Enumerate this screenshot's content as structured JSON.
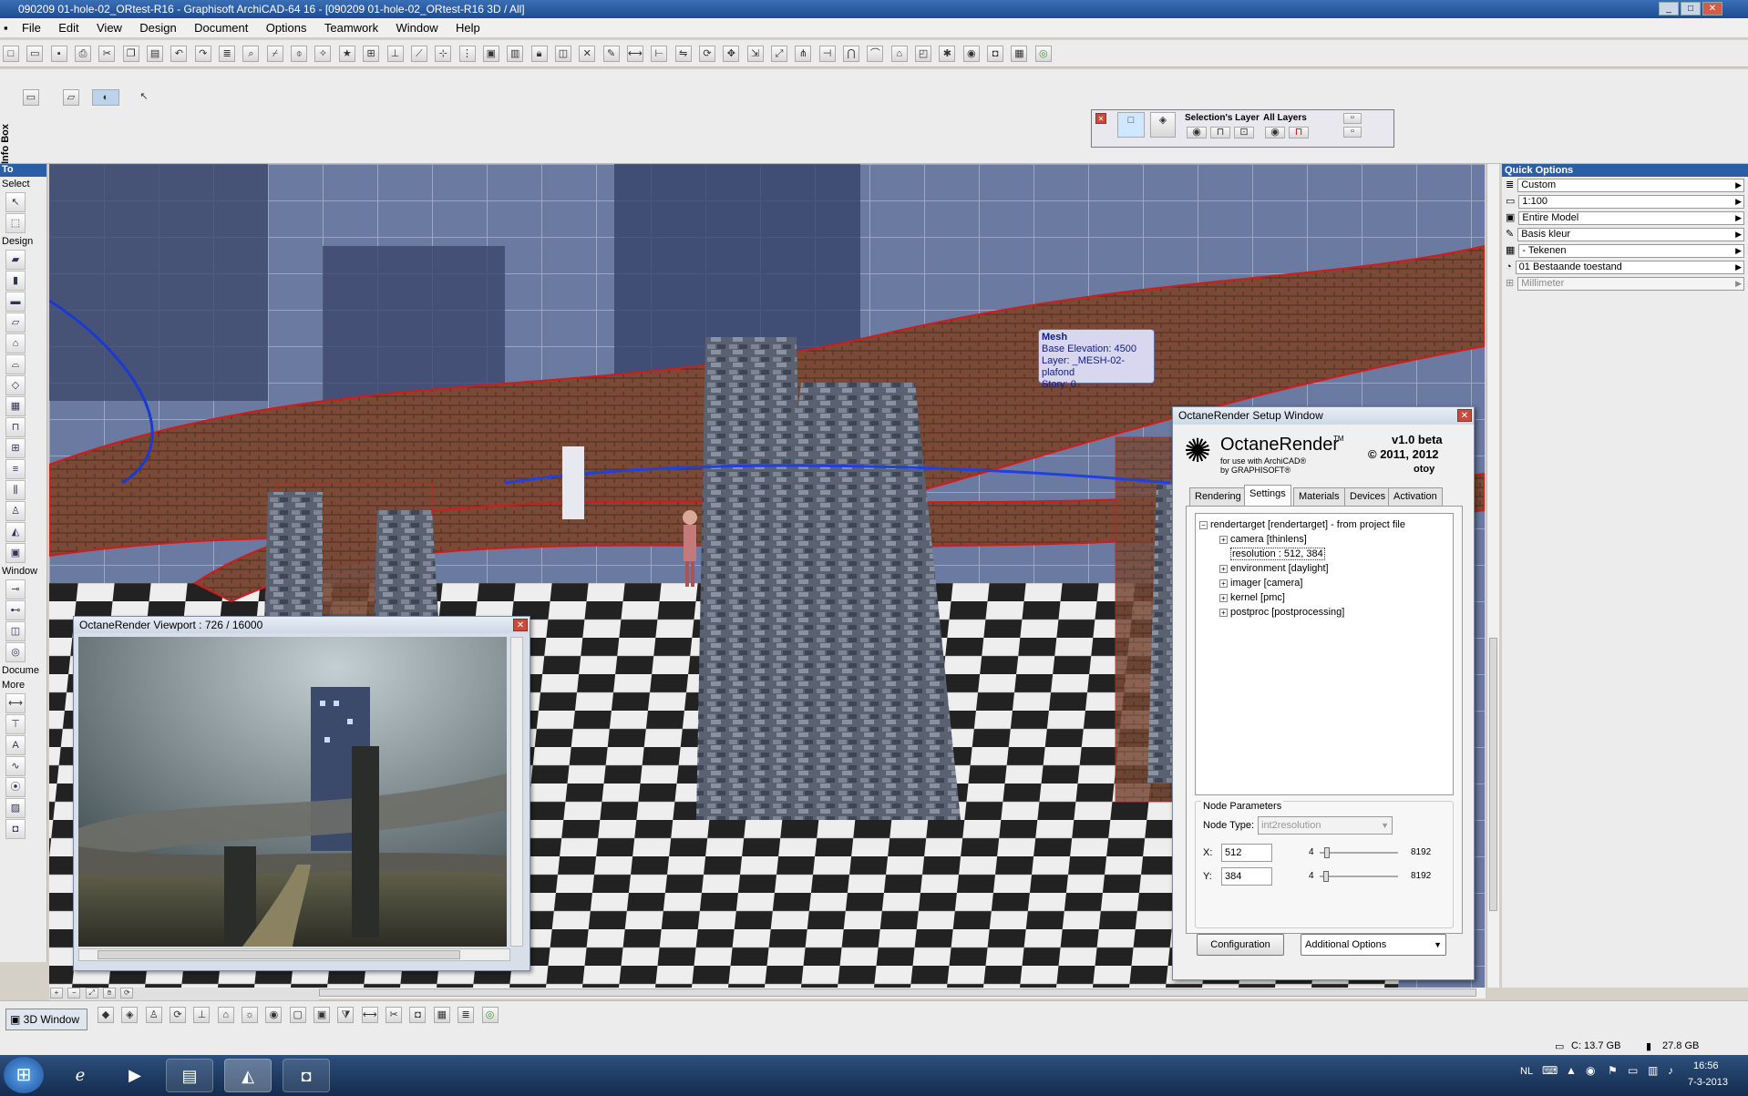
{
  "window": {
    "title": "090209 01-hole-02_ORtest-R16 - Graphisoft ArchiCAD-64 16 - [090209 01-hole-02_ORtest-R16 3D / All]"
  },
  "menu": [
    "File",
    "Edit",
    "View",
    "Design",
    "Document",
    "Options",
    "Teamwork",
    "Window",
    "Help"
  ],
  "infobox": {
    "label": "Info Box"
  },
  "layers": {
    "selection_label": "Selection's Layer",
    "all_label": "All Layers"
  },
  "toolbox": {
    "header": "To",
    "select_label": "Select",
    "design_label": "Design",
    "window_label": "Window",
    "document_label": "Docume",
    "more_label": "More"
  },
  "quick_options": {
    "header": "Quick Options",
    "rows": [
      {
        "value": "Custom",
        "icon": "layers-icon"
      },
      {
        "value": "1:100",
        "icon": "scale-icon"
      },
      {
        "value": "Entire Model",
        "icon": "model-icon"
      },
      {
        "value": "Basis kleur",
        "icon": "pen-icon"
      },
      {
        "value": "- Tekenen",
        "icon": "drawing-icon"
      },
      {
        "value": "01 Bestaande toestand",
        "icon": "renovation-icon"
      },
      {
        "value": "Millimeter",
        "icon": "dimension-icon"
      }
    ]
  },
  "tooltip": {
    "title": "Mesh",
    "base_elevation": "Base Elevation: 4500",
    "layer": "Layer: _MESH-02-plafond",
    "story": "Story: 0"
  },
  "viewer": {
    "title": "OctaneRender Viewport : 726  / 16000"
  },
  "octane": {
    "title": "OctaneRender Setup Window",
    "brand": "OctaneRender",
    "tm": "TM",
    "sub1": "for use with ArchiCAD®",
    "sub2": "by GRAPHISOFT®",
    "version": "v1.0 beta",
    "copyright": "© 2011, 2012",
    "otoy": "otoy",
    "tabs": [
      "Rendering",
      "Settings",
      "Materials",
      "Devices",
      "Activation"
    ],
    "active_tab": "Settings",
    "tree_root": "rendertarget  [rendertarget] - from project file",
    "tree": [
      {
        "label": "camera  [thinlens]",
        "expandable": true
      },
      {
        "label": "resolution : 512, 384",
        "expandable": false,
        "selected": true
      },
      {
        "label": "environment  [daylight]",
        "expandable": true
      },
      {
        "label": "imager  [camera]",
        "expandable": true
      },
      {
        "label": "kernel  [pmc]",
        "expandable": true
      },
      {
        "label": "postproc  [postprocessing]",
        "expandable": true
      }
    ],
    "node_params_label": "Node Parameters",
    "node_type_label": "Node Type:",
    "node_type_value": "int2resolution",
    "x_label": "X:",
    "x_value": "512",
    "y_label": "Y:",
    "y_value": "384",
    "slider_min": "4",
    "slider_max": "8192",
    "x_slider_fraction": 0.06,
    "y_slider_fraction": 0.05,
    "config_button": "Configuration",
    "additional_options": "Additional Options"
  },
  "bottombar": {
    "view_tab": "3D Window"
  },
  "status": {
    "disk_c": "C: 13.7 GB",
    "disk2": "27.8 GB"
  },
  "taskbar": {
    "lang": "NL",
    "time": "16:56",
    "date": "7-3-2013"
  },
  "colors": {
    "accent": "#2b5ea6",
    "title_bar": "#1e4c92"
  }
}
